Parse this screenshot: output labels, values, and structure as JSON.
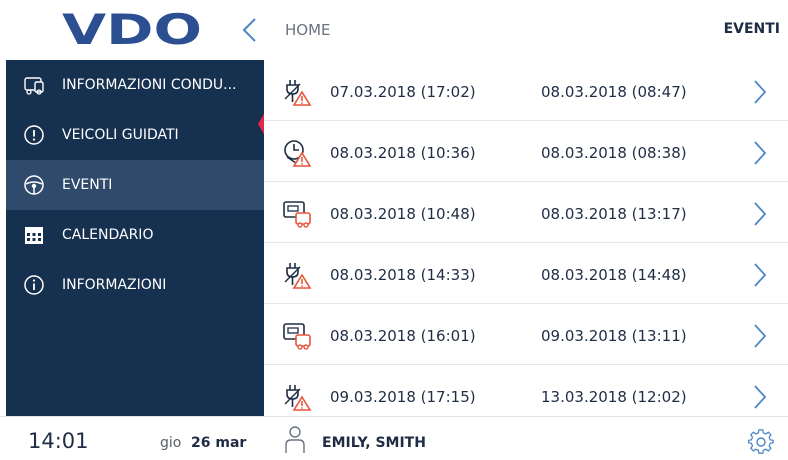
{
  "header": {
    "logo_text": "VDO",
    "breadcrumb": "HOME",
    "title": "EVENTI"
  },
  "sidebar": {
    "items": [
      {
        "label": "INFORMAZIONI CONDU...",
        "icon": "driver-card-icon",
        "active": false
      },
      {
        "label": "VEICOLI GUIDATI",
        "icon": "warning-circle-icon",
        "active": false
      },
      {
        "label": "EVENTI",
        "icon": "steering-wheel-icon",
        "active": true
      },
      {
        "label": "CALENDARIO",
        "icon": "calendar-icon",
        "active": false
      },
      {
        "label": "INFORMAZIONI",
        "icon": "info-icon",
        "active": false
      }
    ]
  },
  "events": [
    {
      "icon": "power-interruption-warning-icon",
      "start": "07.03.2018 (17:02)",
      "end": "08.03.2018 (08:47)"
    },
    {
      "icon": "time-overlap-warning-icon",
      "start": "08.03.2018 (10:36)",
      "end": "08.03.2018 (08:38)"
    },
    {
      "icon": "vehicle-card-warning-icon",
      "start": "08.03.2018 (10:48)",
      "end": "08.03.2018 (13:17)"
    },
    {
      "icon": "power-interruption-warning-icon",
      "start": "08.03.2018 (14:33)",
      "end": "08.03.2018 (14:48)"
    },
    {
      "icon": "vehicle-card-warning-icon",
      "start": "08.03.2018 (16:01)",
      "end": "09.03.2018 (13:11)"
    },
    {
      "icon": "power-interruption-warning-icon",
      "start": "09.03.2018 (17:15)",
      "end": "13.03.2018 (12:02)"
    }
  ],
  "footer": {
    "time": "14:01",
    "weekday": "gio",
    "date": "26 mar",
    "user": "EMILY, SMITH"
  },
  "colors": {
    "sidebar": "#16304f",
    "sidebar_active": "#2f4a6a",
    "accent": "#4a86c5",
    "marker": "#e0284a",
    "warning": "#e8553a"
  }
}
